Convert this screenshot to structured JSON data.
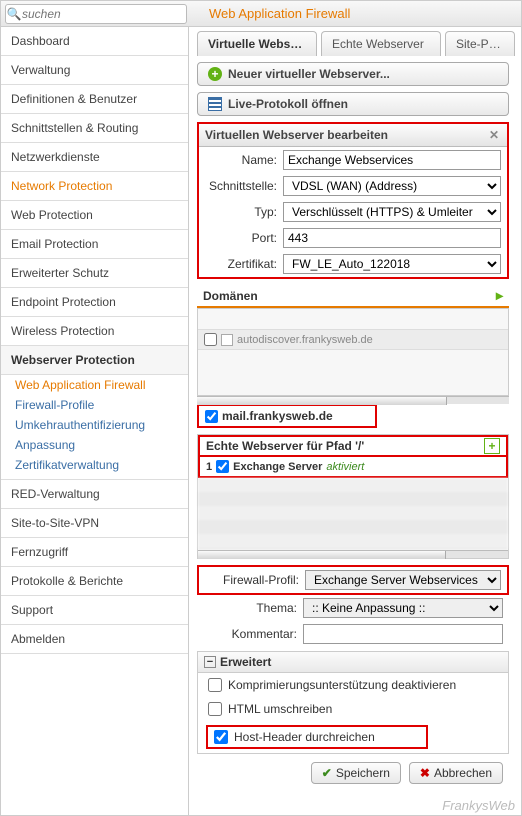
{
  "search_placeholder": "suchen",
  "header_title": "Web Application Firewall",
  "sidebar": {
    "items": [
      {
        "label": "Dashboard"
      },
      {
        "label": "Verwaltung"
      },
      {
        "label": "Definitionen & Benutzer"
      },
      {
        "label": "Schnittstellen & Routing"
      },
      {
        "label": "Netzwerkdienste"
      },
      {
        "label": "Network Protection"
      },
      {
        "label": "Web Protection"
      },
      {
        "label": "Email Protection"
      },
      {
        "label": "Erweiterter Schutz"
      },
      {
        "label": "Endpoint Protection"
      },
      {
        "label": "Wireless Protection"
      },
      {
        "label": "Webserver Protection"
      },
      {
        "label": "RED-Verwaltung"
      },
      {
        "label": "Site-to-Site-VPN"
      },
      {
        "label": "Fernzugriff"
      },
      {
        "label": "Protokolle & Berichte"
      },
      {
        "label": "Support"
      },
      {
        "label": "Abmelden"
      }
    ],
    "subs": [
      {
        "label": "Web Application Firewall"
      },
      {
        "label": "Firewall-Profile"
      },
      {
        "label": "Umkehrauthentifizierung"
      },
      {
        "label": "Anpassung"
      },
      {
        "label": "Zertifikatverwaltung"
      }
    ]
  },
  "tabs": [
    {
      "label": "Virtuelle Webs…"
    },
    {
      "label": "Echte Webserver"
    },
    {
      "label": "Site-Path-R"
    }
  ],
  "buttons": {
    "new_server": "Neuer virtueller Webserver...",
    "live_log": "Live-Protokoll öffnen",
    "save": "Speichern",
    "cancel": "Abbrechen"
  },
  "panel": {
    "title": "Virtuellen Webserver bearbeiten",
    "name_lbl": "Name:",
    "name_val": "Exchange Webservices",
    "iface_lbl": "Schnittstelle:",
    "iface_val": "VDSL (WAN) (Address)",
    "type_lbl": "Typ:",
    "type_val": "Verschlüsselt (HTTPS) & Umleiter",
    "port_lbl": "Port:",
    "port_val": "443",
    "cert_lbl": "Zertifikat:",
    "cert_val": "FW_LE_Auto_122018"
  },
  "domains": {
    "heading": "Domänen",
    "item_unchecked": "autodiscover.frankysweb.de",
    "item_checked": "mail.frankysweb.de"
  },
  "real": {
    "heading": "Echte Webserver für Pfad '/'",
    "num": "1",
    "name": "Exchange Server",
    "state": "aktiviert"
  },
  "fw": {
    "profile_lbl": "Firewall-Profil:",
    "profile_val": "Exchange Server Webservices",
    "theme_lbl": "Thema:",
    "theme_val": ":: Keine Anpassung ::",
    "comment_lbl": "Kommentar:",
    "comment_val": ""
  },
  "ext": {
    "heading": "Erweitert",
    "opt1": "Komprimierungsunterstützung deaktivieren",
    "opt2": "HTML umschreiben",
    "opt3": "Host-Header durchreichen"
  },
  "watermark": "FrankysWeb"
}
